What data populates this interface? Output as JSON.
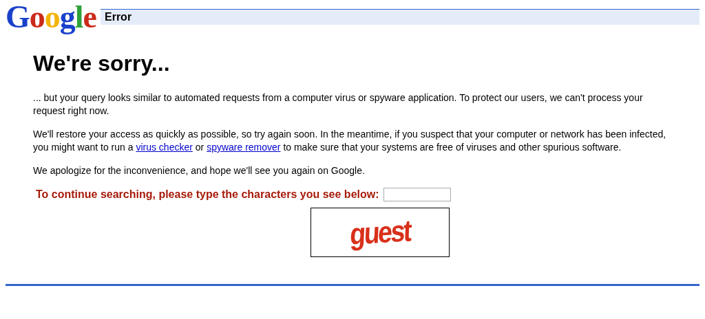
{
  "header": {
    "logo": "Google",
    "title": "Error"
  },
  "heading": "We're sorry...",
  "paragraphs": [
    [
      {
        "kind": "text",
        "text": "... but your query looks similar to automated requests from a computer virus or spyware application. To protect our users, we can't process your request right now."
      }
    ],
    [
      {
        "kind": "text",
        "text": "We'll restore your access as quickly as possible, so try again soon. In the meantime, if you suspect that your computer or network has been infected, you might want to run a "
      },
      {
        "kind": "link",
        "text": "virus checker"
      },
      {
        "kind": "text",
        "text": " or "
      },
      {
        "kind": "link",
        "text": "spyware remover"
      },
      {
        "kind": "text",
        "text": " to make sure that your systems are free of viruses and other spurious software."
      }
    ],
    [
      {
        "kind": "text",
        "text": "We apologize for the inconvenience, and hope we'll see you again on Google."
      }
    ]
  ],
  "captcha": {
    "prompt": "To continue searching, please type the characters you see below:",
    "image_text": "guest"
  }
}
